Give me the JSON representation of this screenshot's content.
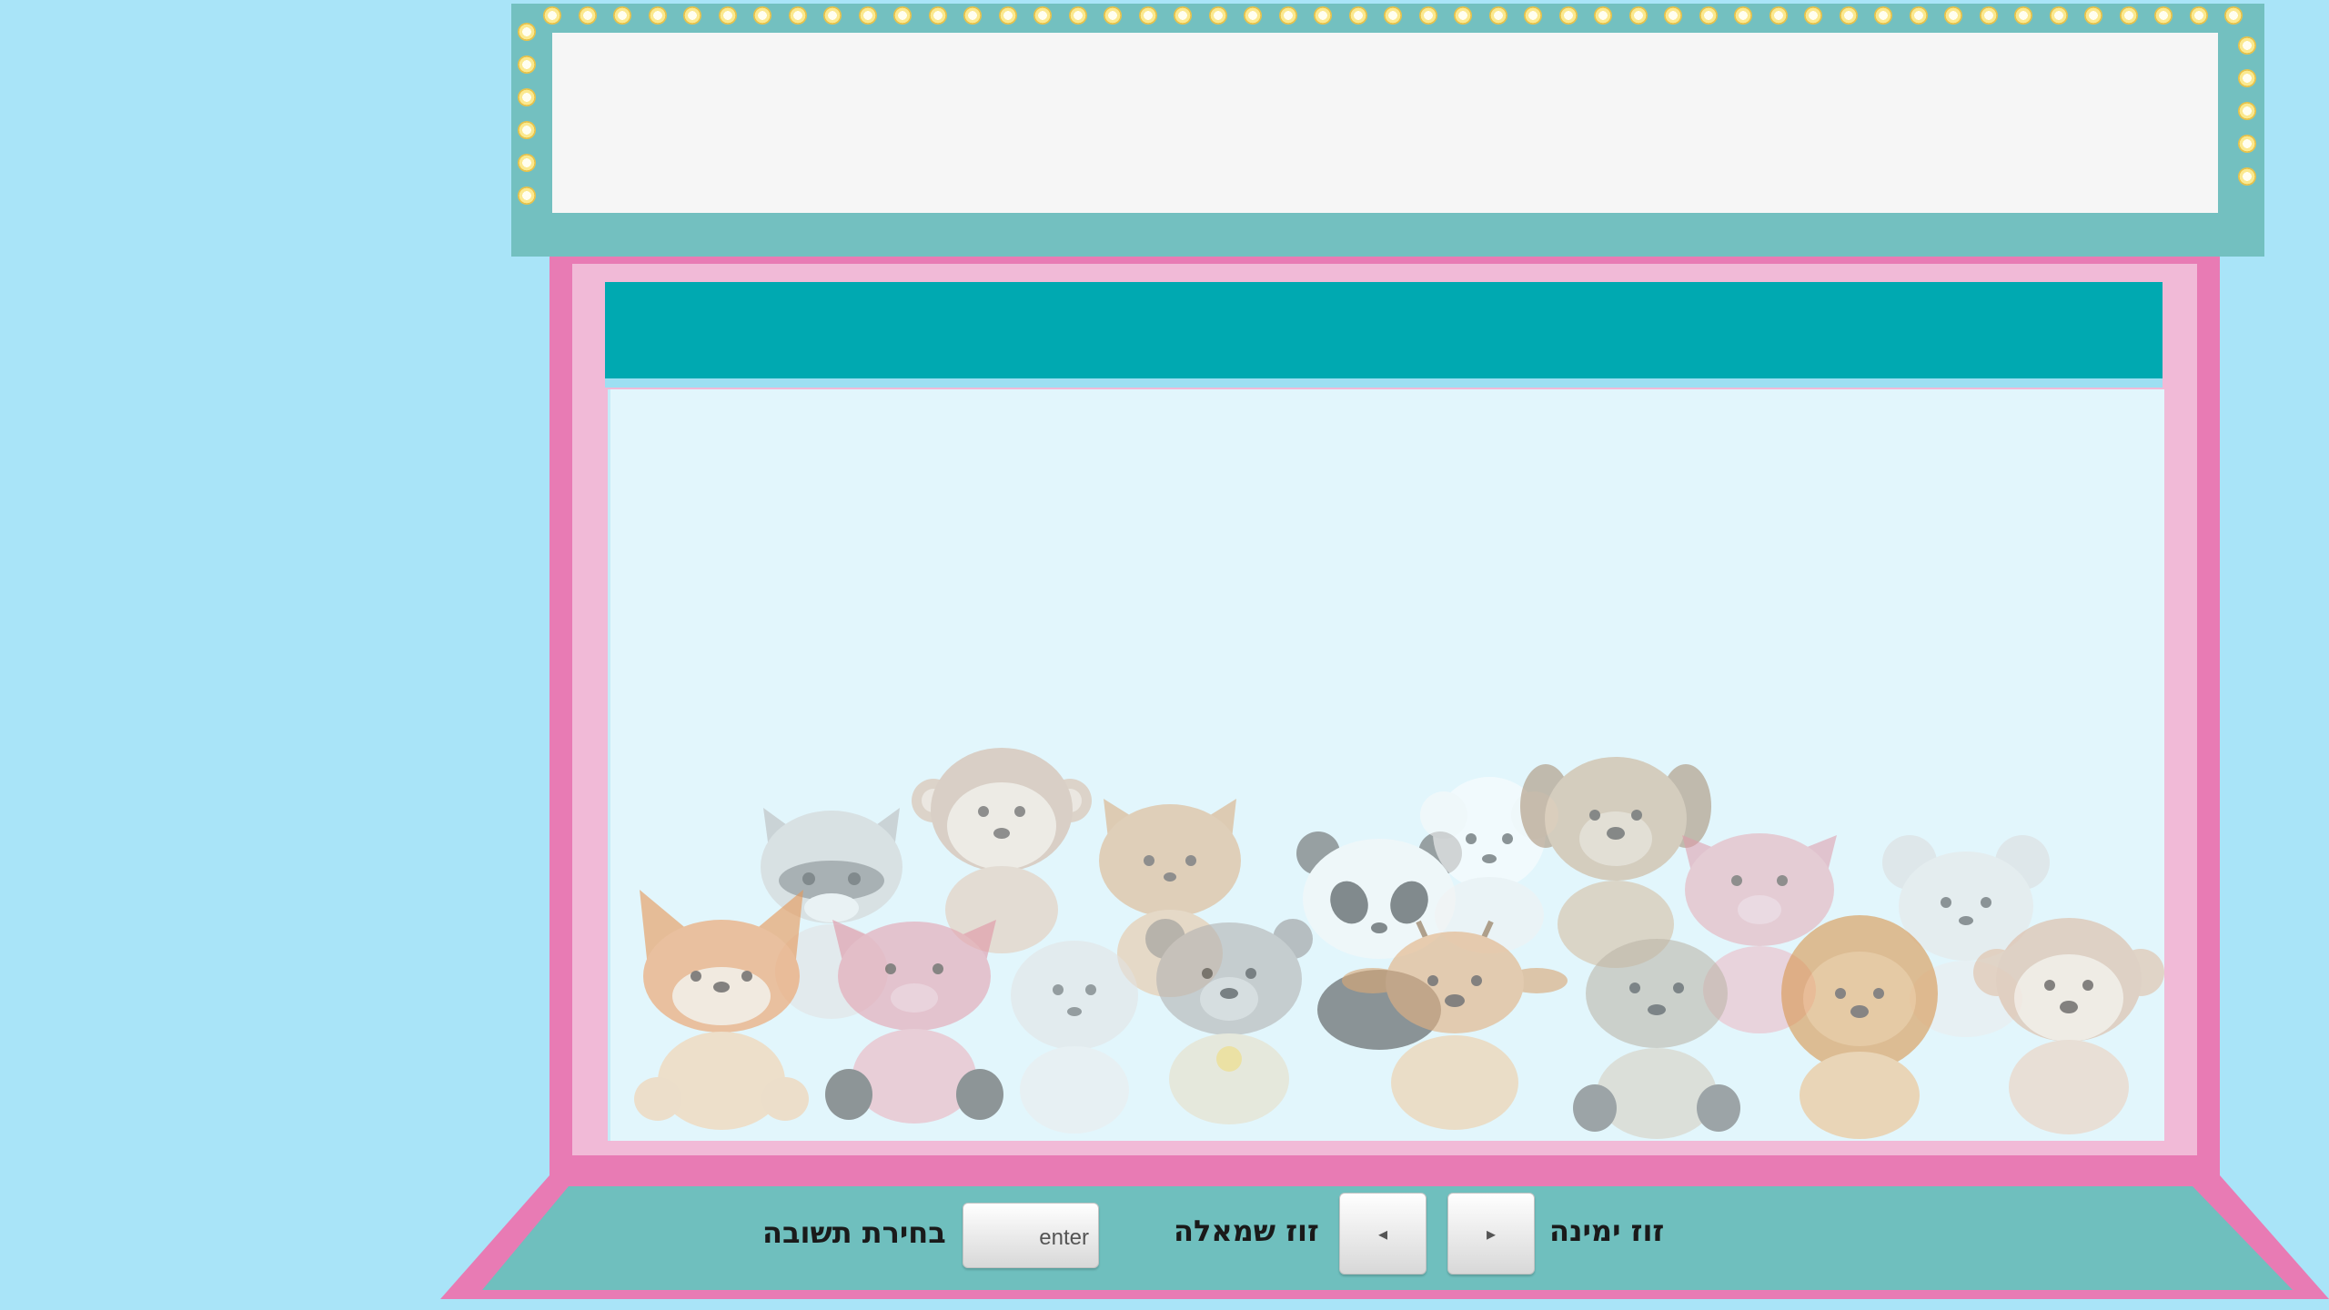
{
  "controls": {
    "move_right_label": "זוז ימינה",
    "move_left_label": "זוז שמאלה",
    "enter_key_label": "enter",
    "select_answer_label": "בחירת תשובה",
    "right_arrow_glyph": "▸",
    "left_arrow_glyph": "◂"
  },
  "marquee": {
    "text": ""
  },
  "banner": {
    "text": ""
  },
  "prizes": [
    "raccoon",
    "monkey",
    "cat",
    "panda",
    "sheep",
    "dog",
    "fox",
    "pig",
    "mouse",
    "hippo",
    "bear",
    "deer",
    "seal",
    "pig",
    "lion",
    "mouse",
    "monkey"
  ],
  "colors": {
    "background": "#a9e4f8",
    "marquee_frame": "#73c0c0",
    "cabinet": "#e87bb4",
    "cabinet_inner": "#f1bad7",
    "banner": "#00a9b1",
    "glass": "#e2f6fc",
    "panel": "#6fbfbe"
  }
}
